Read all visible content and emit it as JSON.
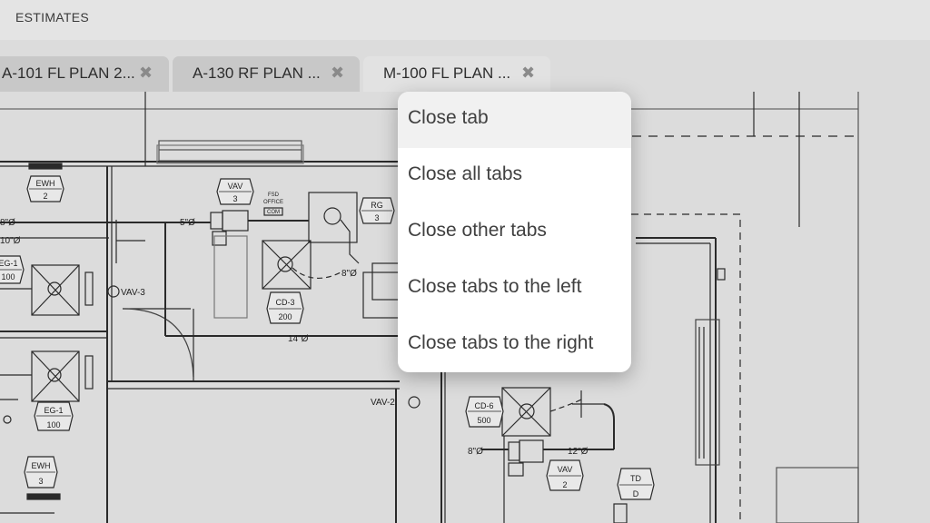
{
  "app": {
    "title": "ESTIMATES"
  },
  "tabs": [
    {
      "label": "A-101 FL PLAN 2...",
      "close": "✖",
      "active": false
    },
    {
      "label": "A-130 RF PLAN ...",
      "close": "✖",
      "active": false
    },
    {
      "label": "M-100 FL PLAN ...",
      "close": "✖",
      "active": true
    }
  ],
  "context_menu": {
    "items": [
      {
        "label": "Close tab",
        "hovered": true
      },
      {
        "label": "Close all tabs"
      },
      {
        "label": "Close other tabs"
      },
      {
        "label": "Close tabs to the left"
      },
      {
        "label": "Close tabs to the right"
      }
    ]
  },
  "drawing": {
    "tags": [
      {
        "top": "EWH",
        "bottom": "2"
      },
      {
        "top": "VAV",
        "bottom": "3"
      },
      {
        "top": "RG",
        "bottom": "3"
      },
      {
        "top": "EG-1",
        "bottom": "100"
      },
      {
        "top": "CD-3",
        "bottom": "200"
      },
      {
        "top": "EG-1",
        "bottom": "100"
      },
      {
        "top": "EWH",
        "bottom": "3"
      },
      {
        "top": "CD-6",
        "bottom": "500"
      },
      {
        "top": "VAV",
        "bottom": "2"
      },
      {
        "top": "TD",
        "bottom": "D"
      }
    ],
    "labels": {
      "duct_8a": "8\"Ø",
      "duct_10": "10\"Ø",
      "duct_5": "5\"Ø",
      "duct_8b": "8\"Ø",
      "duct_14": "14\"Ø",
      "duct_8c": "8\"Ø",
      "duct_12": "12\"Ø",
      "vav3": "VAV-3",
      "vav2": "VAV-2",
      "fsd1": "FSD",
      "fsd2": "OFFICE",
      "fsd3": "COM"
    }
  }
}
